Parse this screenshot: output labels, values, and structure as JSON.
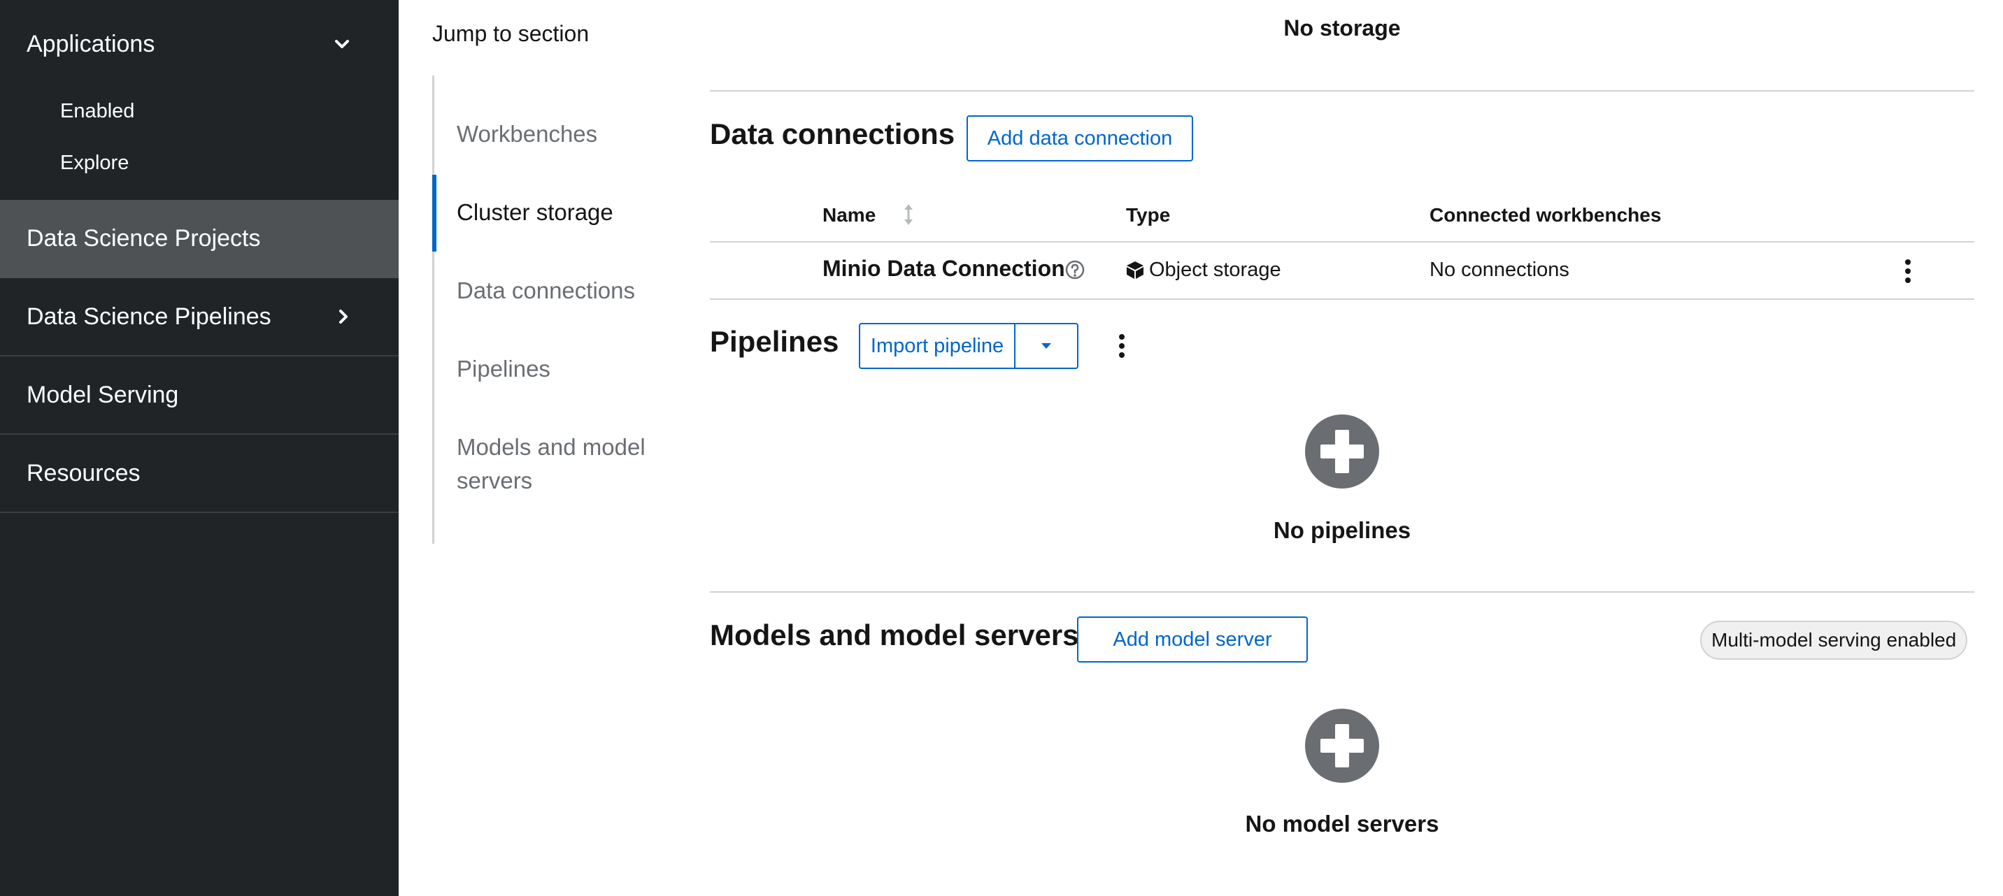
{
  "sidebar": {
    "applications": {
      "label": "Applications",
      "expanded": true,
      "items": [
        {
          "label": "Enabled"
        },
        {
          "label": "Explore"
        }
      ]
    },
    "items": [
      {
        "label": "Data Science Projects",
        "active": true
      },
      {
        "label": "Data Science Pipelines",
        "has_children": true
      },
      {
        "label": "Model Serving"
      },
      {
        "label": "Resources"
      }
    ]
  },
  "jump": {
    "title": "Jump to section",
    "links": [
      {
        "label": "Workbenches"
      },
      {
        "label": "Cluster storage",
        "current": true
      },
      {
        "label": "Data connections"
      },
      {
        "label": "Pipelines"
      },
      {
        "label": "Models and model servers"
      }
    ]
  },
  "storage": {
    "empty_text": "No storage"
  },
  "data_connections": {
    "title": "Data connections",
    "add_button": "Add data connection",
    "columns": {
      "name": "Name",
      "type": "Type",
      "connected": "Connected workbenches"
    },
    "rows": [
      {
        "name": "Minio Data Connection",
        "type": "Object storage",
        "connected": "No connections"
      }
    ]
  },
  "pipelines": {
    "title": "Pipelines",
    "import_button": "Import pipeline",
    "empty_text": "No pipelines"
  },
  "models": {
    "title": "Models and model servers",
    "add_button": "Add model server",
    "badge": "Multi-model serving enabled",
    "empty_text": "No model servers"
  },
  "colors": {
    "sidebar_bg": "#212427",
    "sidebar_active": "#4f5255",
    "accent": "#0066cc",
    "empty_icon": "#6a6e73"
  },
  "icons": {
    "applications_toggle": "chevron-down-icon",
    "pipelines_toggle": "chevron-right-icon",
    "sort": "sort-icon",
    "help": "help-icon",
    "object_storage": "cube-icon",
    "kebab": "kebab-icon",
    "empty_state": "plus-circle-icon",
    "import_toggle": "caret-down-icon"
  }
}
